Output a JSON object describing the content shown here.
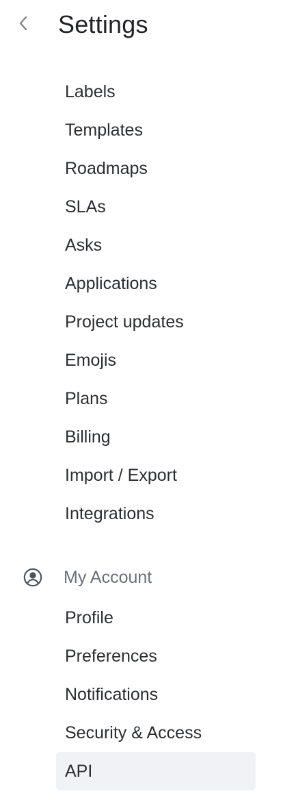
{
  "header": {
    "title": "Settings",
    "back_icon": "chevron-left-icon"
  },
  "workspace_menu": {
    "items": [
      {
        "label": "Labels"
      },
      {
        "label": "Templates"
      },
      {
        "label": "Roadmaps"
      },
      {
        "label": "SLAs"
      },
      {
        "label": "Asks"
      },
      {
        "label": "Applications"
      },
      {
        "label": "Project updates"
      },
      {
        "label": "Emojis"
      },
      {
        "label": "Plans"
      },
      {
        "label": "Billing"
      },
      {
        "label": "Import / Export"
      },
      {
        "label": "Integrations"
      }
    ]
  },
  "account_section": {
    "title": "My Account",
    "icon": "user-circle-icon",
    "items": [
      {
        "label": "Profile"
      },
      {
        "label": "Preferences"
      },
      {
        "label": "Notifications"
      },
      {
        "label": "Security & Access"
      },
      {
        "label": "API",
        "active": true
      }
    ]
  },
  "colors": {
    "active_background": "#f1f2f6",
    "text_primary": "#2b2d31",
    "text_secondary": "#6b6f76"
  }
}
